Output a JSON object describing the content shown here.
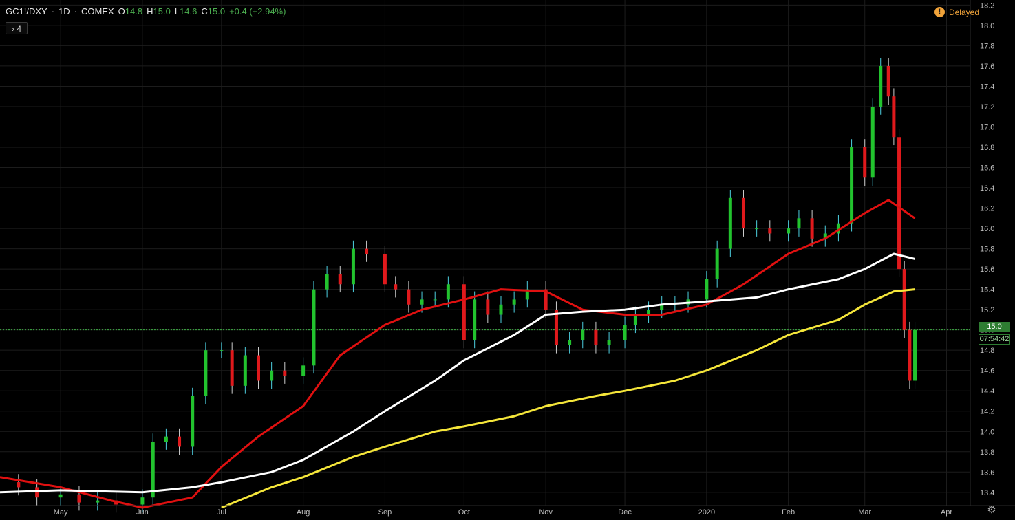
{
  "header": {
    "symbol": "GC1!/DXY",
    "interval": "1D",
    "exchange": "COMEX",
    "open_label": "O",
    "open": "14.8",
    "high_label": "H",
    "high": "15.0",
    "low_label": "L",
    "low": "14.6",
    "close_label": "C",
    "close": "15.0",
    "change": "+0.4 (+2.94%)"
  },
  "indicators_button": {
    "icon": "chevron-right-icon",
    "label": "4"
  },
  "status": {
    "label": "Delayed",
    "icon": "exclamation-icon",
    "color": "#f0a33a"
  },
  "price_label": "15.0",
  "countdown": "07:54:42",
  "settings_icon": "gear-icon",
  "colors": {
    "up": "#22c32e",
    "down": "#e0191c",
    "up_wick": "#4dd0e1",
    "ma_red": "#e01010",
    "ma_white": "#ffffff",
    "ma_yellow": "#f5e63a",
    "grid": "#1c1c1c",
    "price_line": "#3cb043"
  },
  "chart_data": {
    "type": "candlestick",
    "y_ticks": [
      "13.4",
      "13.6",
      "13.8",
      "14.0",
      "14.2",
      "14.4",
      "14.6",
      "14.8",
      "15.0",
      "15.2",
      "15.4",
      "15.6",
      "15.8",
      "16.0",
      "16.2",
      "16.4",
      "16.6",
      "16.8",
      "17.0",
      "17.2",
      "17.4",
      "17.6",
      "17.8",
      "18.0",
      "18.2"
    ],
    "ylim": [
      13.27,
      18.25
    ],
    "x_ticks": [
      "May",
      "Jun",
      "Jul",
      "Aug",
      "Sep",
      "Oct",
      "Nov",
      "Dec",
      "2020",
      "Feb",
      "Mar",
      "Apr"
    ],
    "x_tick_dates": [
      "2019-05-01",
      "2019-06-01",
      "2019-07-01",
      "2019-08-01",
      "2019-09-01",
      "2019-10-01",
      "2019-11-01",
      "2019-12-01",
      "2020-01-01",
      "2020-02-01",
      "2020-03-01",
      "2020-04-01"
    ],
    "date_range": [
      "2019-04-08",
      "2020-04-10"
    ],
    "current_price": 15.0,
    "close_series": {
      "dates": [
        "2019-04-08",
        "2019-04-15",
        "2019-04-22",
        "2019-05-01",
        "2019-05-08",
        "2019-05-15",
        "2019-05-22",
        "2019-06-01",
        "2019-06-05",
        "2019-06-10",
        "2019-06-15",
        "2019-06-20",
        "2019-06-25",
        "2019-07-01",
        "2019-07-05",
        "2019-07-10",
        "2019-07-15",
        "2019-07-20",
        "2019-07-25",
        "2019-08-01",
        "2019-08-05",
        "2019-08-10",
        "2019-08-15",
        "2019-08-20",
        "2019-08-25",
        "2019-09-01",
        "2019-09-05",
        "2019-09-10",
        "2019-09-15",
        "2019-09-20",
        "2019-09-25",
        "2019-10-01",
        "2019-10-05",
        "2019-10-10",
        "2019-10-15",
        "2019-10-20",
        "2019-10-25",
        "2019-11-01",
        "2019-11-05",
        "2019-11-10",
        "2019-11-15",
        "2019-11-20",
        "2019-11-25",
        "2019-12-01",
        "2019-12-05",
        "2019-12-10",
        "2019-12-15",
        "2019-12-20",
        "2019-12-25",
        "2020-01-01",
        "2020-01-05",
        "2020-01-10",
        "2020-01-15",
        "2020-01-20",
        "2020-01-25",
        "2020-02-01",
        "2020-02-05",
        "2020-02-10",
        "2020-02-15",
        "2020-02-20",
        "2020-02-25",
        "2020-03-01",
        "2020-03-04",
        "2020-03-07",
        "2020-03-10",
        "2020-03-12",
        "2020-03-14",
        "2020-03-16",
        "2020-03-18",
        "2020-03-20"
      ],
      "values": [
        13.5,
        13.45,
        13.35,
        13.38,
        13.3,
        13.32,
        13.28,
        13.35,
        13.9,
        13.95,
        13.85,
        14.35,
        14.8,
        14.8,
        14.45,
        14.75,
        14.5,
        14.6,
        14.55,
        14.65,
        15.4,
        15.55,
        15.45,
        15.8,
        15.75,
        15.45,
        15.4,
        15.25,
        15.3,
        15.3,
        15.45,
        14.9,
        15.3,
        15.15,
        15.25,
        15.3,
        15.4,
        15.2,
        14.85,
        14.9,
        15.0,
        14.85,
        14.9,
        15.05,
        15.15,
        15.2,
        15.25,
        15.25,
        15.3,
        15.5,
        15.8,
        16.3,
        16.0,
        16.0,
        15.95,
        16.0,
        16.1,
        15.9,
        15.95,
        16.05,
        16.8,
        16.5,
        17.2,
        17.6,
        17.3,
        16.9,
        15.6,
        15.0,
        14.5,
        15.0
      ]
    },
    "series": [
      {
        "color": "#e01010",
        "dates": [
          "2019-04-08",
          "2019-05-01",
          "2019-05-20",
          "2019-06-01",
          "2019-06-20",
          "2019-07-01",
          "2019-07-15",
          "2019-08-01",
          "2019-08-15",
          "2019-09-01",
          "2019-09-15",
          "2019-10-01",
          "2019-10-15",
          "2019-11-01",
          "2019-11-15",
          "2019-12-01",
          "2019-12-15",
          "2020-01-01",
          "2020-01-15",
          "2020-02-01",
          "2020-02-15",
          "2020-03-01",
          "2020-03-10",
          "2020-03-20"
        ],
        "values": [
          13.55,
          13.45,
          13.32,
          13.25,
          13.35,
          13.65,
          13.95,
          14.25,
          14.75,
          15.05,
          15.2,
          15.3,
          15.4,
          15.38,
          15.2,
          15.15,
          15.15,
          15.25,
          15.45,
          15.75,
          15.9,
          16.15,
          16.28,
          16.1
        ]
      },
      {
        "color": "#ffffff",
        "dates": [
          "2019-04-08",
          "2019-05-01",
          "2019-06-01",
          "2019-06-20",
          "2019-07-01",
          "2019-07-20",
          "2019-08-01",
          "2019-08-20",
          "2019-09-01",
          "2019-09-20",
          "2019-10-01",
          "2019-10-20",
          "2019-11-01",
          "2019-11-15",
          "2019-12-01",
          "2019-12-15",
          "2020-01-01",
          "2020-01-20",
          "2020-02-01",
          "2020-02-20",
          "2020-03-01",
          "2020-03-12",
          "2020-03-20"
        ],
        "values": [
          13.4,
          13.42,
          13.4,
          13.45,
          13.5,
          13.6,
          13.72,
          14.0,
          14.2,
          14.5,
          14.7,
          14.95,
          15.15,
          15.18,
          15.2,
          15.25,
          15.28,
          15.32,
          15.4,
          15.5,
          15.6,
          15.75,
          15.7
        ]
      },
      {
        "color": "#f5e63a",
        "dates": [
          "2019-07-01",
          "2019-07-20",
          "2019-08-01",
          "2019-08-20",
          "2019-09-01",
          "2019-09-20",
          "2019-10-01",
          "2019-10-20",
          "2019-11-01",
          "2019-11-20",
          "2019-12-01",
          "2019-12-20",
          "2020-01-01",
          "2020-01-20",
          "2020-02-01",
          "2020-02-20",
          "2020-03-01",
          "2020-03-12",
          "2020-03-20"
        ],
        "values": [
          13.25,
          13.45,
          13.55,
          13.75,
          13.85,
          14.0,
          14.05,
          14.15,
          14.25,
          14.35,
          14.4,
          14.5,
          14.6,
          14.8,
          14.95,
          15.1,
          15.25,
          15.38,
          15.4
        ]
      }
    ]
  }
}
